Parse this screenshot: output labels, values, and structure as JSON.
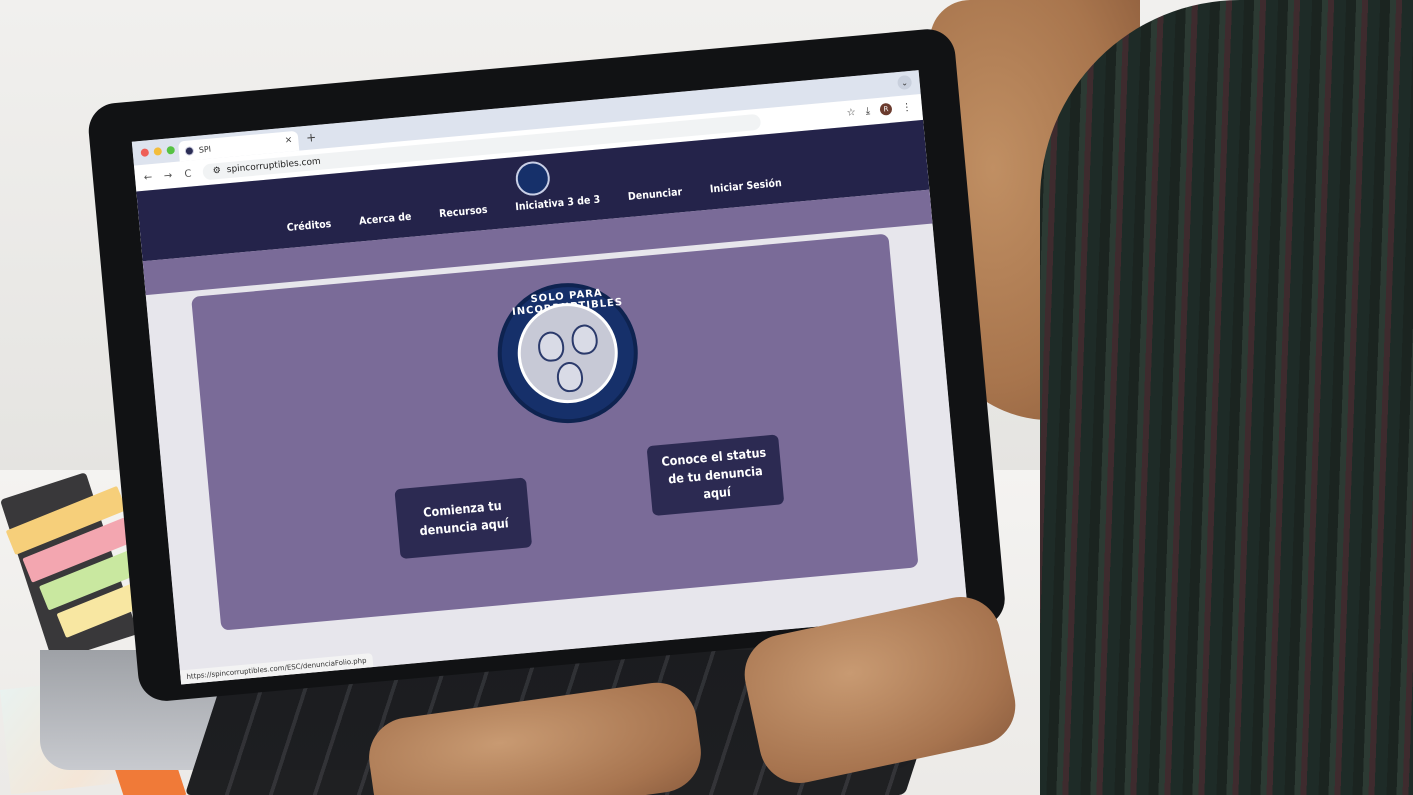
{
  "browser": {
    "tab_title": "SPI",
    "url": "spincorruptibles.com",
    "new_tab": "+",
    "tab_close": "×",
    "back_icon": "arrow-left-icon",
    "forward_icon": "arrow-right-icon",
    "reload_icon": "reload-icon",
    "profile_initial": "R",
    "status_url": "https://spincorruptibles.com/ESC/denunciaFolio.php"
  },
  "site": {
    "nav": [
      "Créditos",
      "Acerca de",
      "Recursos",
      "Iniciativa 3 de 3",
      "Denunciar",
      "Iniciar Sesión"
    ],
    "logo_text": "SOLO PARA INCORRUPTIBLES",
    "buttons": {
      "start": "Comienza tu denuncia aquí",
      "status": "Conoce el status de tu denuncia aquí"
    },
    "colors": {
      "header": "#24234a",
      "card": "#7a6b98",
      "button": "#2c2a52",
      "logo": "#16306a"
    }
  }
}
